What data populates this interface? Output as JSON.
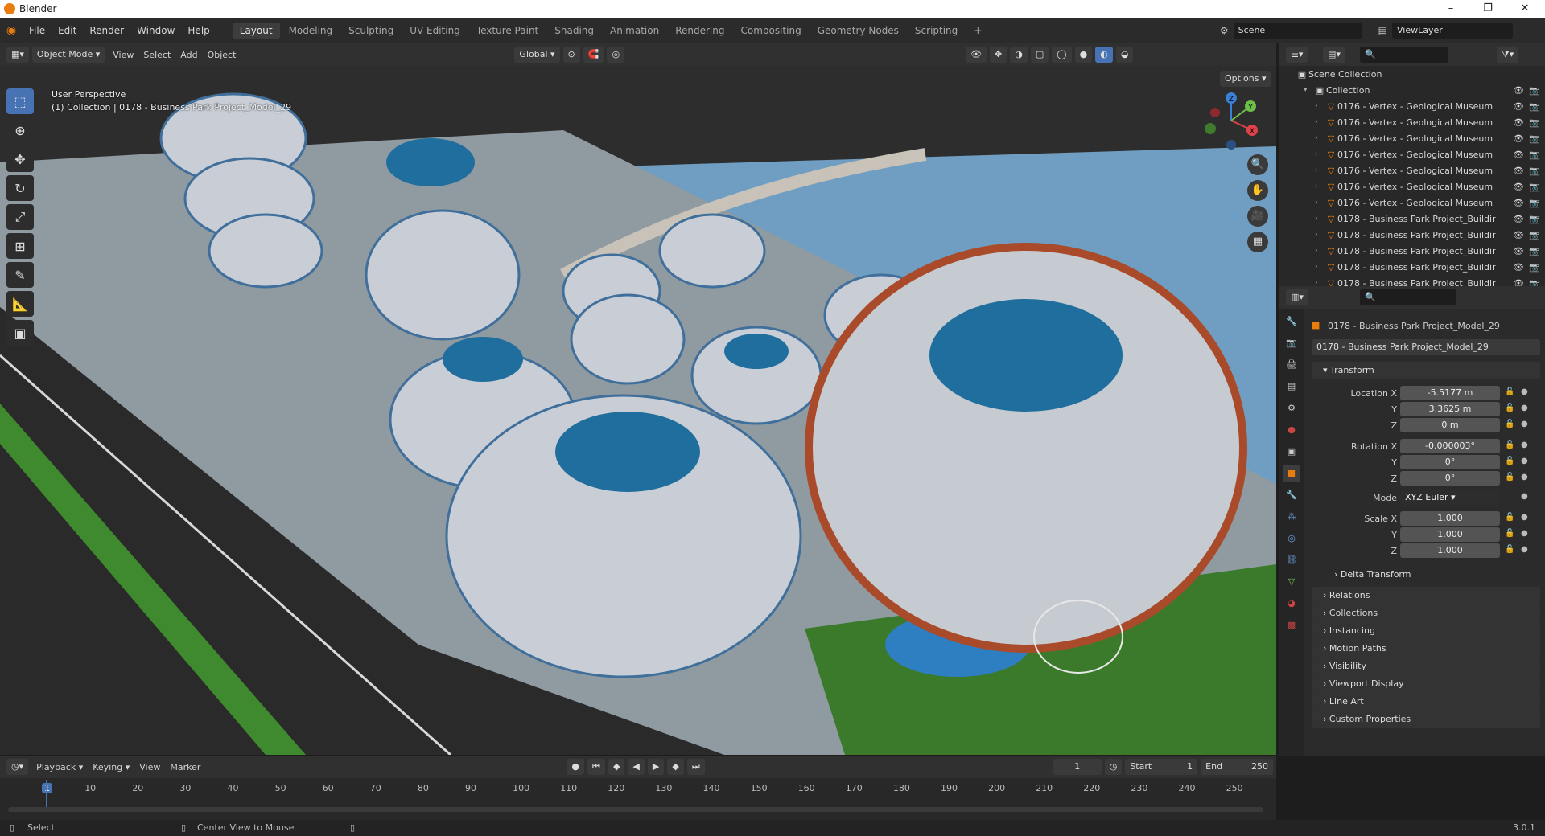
{
  "window": {
    "title": "Blender",
    "min": "–",
    "max": "❐",
    "close": "✕"
  },
  "menu": {
    "items": [
      "File",
      "Edit",
      "Render",
      "Window",
      "Help"
    ]
  },
  "workspaces": {
    "tabs": [
      "Layout",
      "Modeling",
      "Sculpting",
      "UV Editing",
      "Texture Paint",
      "Shading",
      "Animation",
      "Rendering",
      "Compositing",
      "Geometry Nodes",
      "Scripting"
    ],
    "add": "+"
  },
  "scene": {
    "name": "Scene",
    "view_layer": "ViewLayer"
  },
  "viewport_header": {
    "mode": "Object Mode",
    "menus": [
      "View",
      "Select",
      "Add",
      "Object"
    ],
    "transform_orientation": "Global"
  },
  "viewport": {
    "perspective": "User Perspective",
    "context": "(1) Collection | 0178 - Business Park Project_Model_29",
    "options": "Options"
  },
  "gizmo": {
    "z": "Z",
    "y": "Y",
    "x": "X"
  },
  "outliner": {
    "root": "Scene Collection",
    "collection": "Collection",
    "items": [
      "0176 - Vertex - Geological Museum",
      "0176 - Vertex - Geological Museum",
      "0176 - Vertex - Geological Museum",
      "0176 - Vertex - Geological Museum",
      "0176 - Vertex - Geological Museum",
      "0176 - Vertex - Geological Museum",
      "0176 - Vertex - Geological Museum",
      "0178 - Business Park Project_Buildir",
      "0178 - Business Park Project_Buildir",
      "0178 - Business Park Project_Buildir",
      "0178 - Business Park Project_Buildir",
      "0178 - Business Park Project_Buildir"
    ]
  },
  "properties": {
    "object_name": "0178 - Business Park Project_Model_29",
    "object_field": "0178 - Business Park Project_Model_29",
    "transform": {
      "title": "Transform",
      "location": {
        "label": "Location X",
        "x": "-5.5177 m",
        "y": "3.3625 m",
        "z": "0 m"
      },
      "rotation": {
        "label": "Rotation X",
        "x": "-0.000003°",
        "y": "0°",
        "z": "0°"
      },
      "mode_label": "Mode",
      "mode": "XYZ Euler",
      "scale": {
        "label": "Scale X",
        "x": "1.000",
        "y": "1.000",
        "z": "1.000"
      },
      "axis_y": "Y",
      "axis_z": "Z",
      "delta": "Delta Transform"
    },
    "panels": [
      "Relations",
      "Collections",
      "Instancing",
      "Motion Paths",
      "Visibility",
      "Viewport Display",
      "Line Art",
      "Custom Properties"
    ]
  },
  "timeline": {
    "menus": [
      "Playback",
      "Keying",
      "View",
      "Marker"
    ],
    "current_frame": "1",
    "start_label": "Start",
    "start": "1",
    "end_label": "End",
    "end": "250",
    "ticks": [
      "1",
      "10",
      "20",
      "30",
      "40",
      "50",
      "60",
      "70",
      "80",
      "90",
      "100",
      "110",
      "120",
      "130",
      "140",
      "150",
      "160",
      "170",
      "180",
      "190",
      "200",
      "210",
      "220",
      "230",
      "240",
      "250"
    ]
  },
  "status": {
    "select": "Select",
    "center": "Center View to Mouse",
    "version": "3.0.1"
  },
  "colors": {
    "accent": "#4772b3",
    "object_orange": "#e87d0d",
    "sky": "#6f9ec2"
  }
}
